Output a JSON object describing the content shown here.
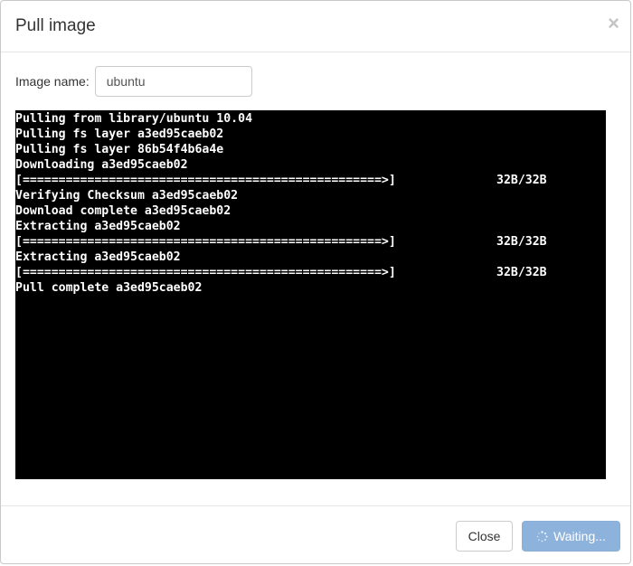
{
  "modal": {
    "title": "Pull image",
    "close_glyph": "×"
  },
  "form": {
    "image_name_label": "Image name:",
    "image_name_value": "ubuntu"
  },
  "terminal": {
    "lines": [
      {
        "text": "Pulling from library/ubuntu 10.04",
        "size": ""
      },
      {
        "text": "Pulling fs layer a3ed95caeb02",
        "size": ""
      },
      {
        "text": "Pulling fs layer 86b54f4b6a4e",
        "size": ""
      },
      {
        "text": "Downloading a3ed95caeb02",
        "size": ""
      },
      {
        "text": "[==================================================>]",
        "size": "32B/32B"
      },
      {
        "text": "Verifying Checksum a3ed95caeb02",
        "size": ""
      },
      {
        "text": "Download complete a3ed95caeb02",
        "size": ""
      },
      {
        "text": "Extracting a3ed95caeb02",
        "size": ""
      },
      {
        "text": "[==================================================>]",
        "size": "32B/32B"
      },
      {
        "text": "Extracting a3ed95caeb02",
        "size": ""
      },
      {
        "text": "[==================================================>]",
        "size": "32B/32B"
      },
      {
        "text": "Pull complete a3ed95caeb02",
        "size": ""
      }
    ]
  },
  "footer": {
    "close_label": "Close",
    "waiting_label": "Waiting..."
  },
  "icons": {
    "close": "close-icon",
    "spinner": "spinner-icon"
  },
  "colors": {
    "terminal_bg": "#000000",
    "terminal_fg": "#ffffff",
    "primary_disabled": "#8db3dc"
  }
}
